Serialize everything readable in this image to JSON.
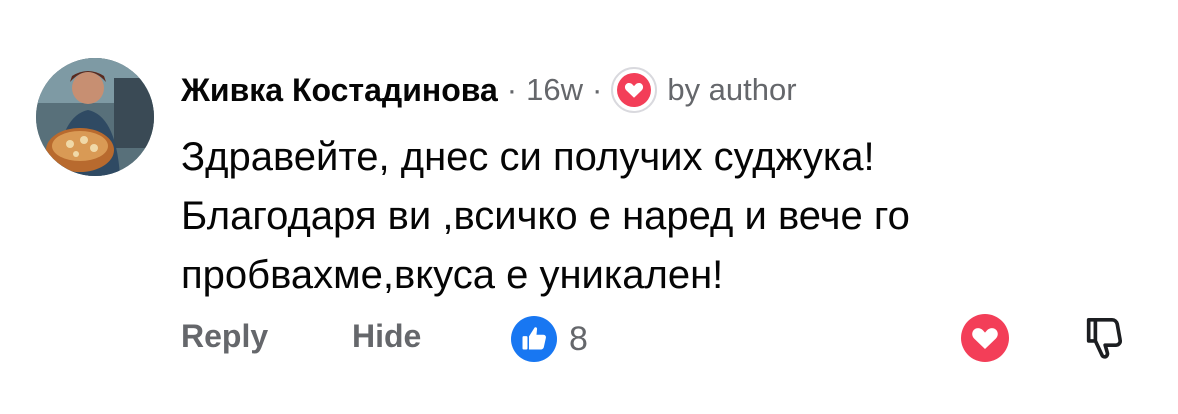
{
  "comment": {
    "author_name": "Живка Костадинова",
    "separator": "·",
    "timestamp": "16w",
    "author_badge": "by author",
    "text_lines": [
      "Здравейте, днес си получих суджука!",
      "Благодаря ви ,всичко е наред и вече го",
      "пробвахме,вкуса е уникален!"
    ]
  },
  "actions": {
    "reply_label": "Reply",
    "hide_label": "Hide",
    "like_count": "8"
  },
  "colors": {
    "like_blue": "#1877f2",
    "heart_red": "#f33e58",
    "muted_text": "#65676b"
  },
  "icons": [
    "heart-icon",
    "like-icon",
    "dislike-icon"
  ]
}
